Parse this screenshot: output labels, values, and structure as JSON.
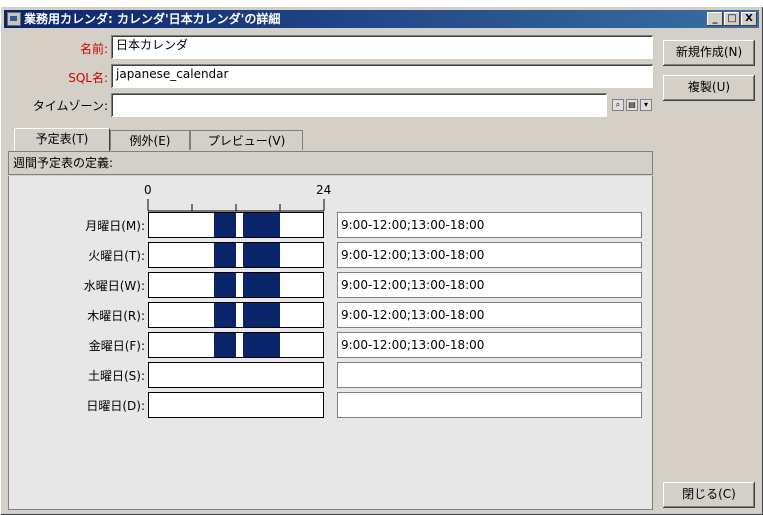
{
  "window": {
    "title": "業務用カレンダ: カレンダ'日本カレンダ'の詳細",
    "controls": {
      "minimize": "_",
      "maximize": "□",
      "close": "X"
    }
  },
  "form": {
    "name_label": "名前:",
    "name_value": "日本カレンダ",
    "sqlname_label": "SQL名:",
    "sqlname_value": "japanese_calendar",
    "timezone_label": "タイムゾーン:",
    "timezone_value": ""
  },
  "buttons": {
    "new": "新規作成(N)",
    "duplicate": "複製(U)",
    "close": "閉じる(C)"
  },
  "tabs": [
    {
      "label": "予定表(T)",
      "active": true
    },
    {
      "label": "例外(E)",
      "active": false
    },
    {
      "label": "プレビュー(V)",
      "active": false
    }
  ],
  "schedule": {
    "section_title": "週間予定表の定義:",
    "scale": {
      "start": "0",
      "end": "24"
    },
    "days": [
      {
        "label": "月曜日(M):",
        "text": "9:00-12:00;13:00-18:00",
        "work_periods": [
          [
            9,
            12
          ],
          [
            13,
            18
          ]
        ]
      },
      {
        "label": "火曜日(T):",
        "text": "9:00-12:00;13:00-18:00",
        "work_periods": [
          [
            9,
            12
          ],
          [
            13,
            18
          ]
        ]
      },
      {
        "label": "水曜日(W):",
        "text": "9:00-12:00;13:00-18:00",
        "work_periods": [
          [
            9,
            12
          ],
          [
            13,
            18
          ]
        ]
      },
      {
        "label": "木曜日(R):",
        "text": "9:00-12:00;13:00-18:00",
        "work_periods": [
          [
            9,
            12
          ],
          [
            13,
            18
          ]
        ]
      },
      {
        "label": "金曜日(F):",
        "text": "9:00-12:00;13:00-18:00",
        "work_periods": [
          [
            9,
            12
          ],
          [
            13,
            18
          ]
        ]
      },
      {
        "label": "土曜日(S):",
        "text": "",
        "work_periods": []
      },
      {
        "label": "日曜日(D):",
        "text": "",
        "work_periods": []
      }
    ]
  },
  "colors": {
    "block": "#0a246a",
    "title_start": "#0a246a",
    "title_end": "#3a6ea5"
  },
  "icons": [
    "app-icon",
    "search-icon",
    "calendar-icon",
    "dropdown-arrow-icon"
  ]
}
